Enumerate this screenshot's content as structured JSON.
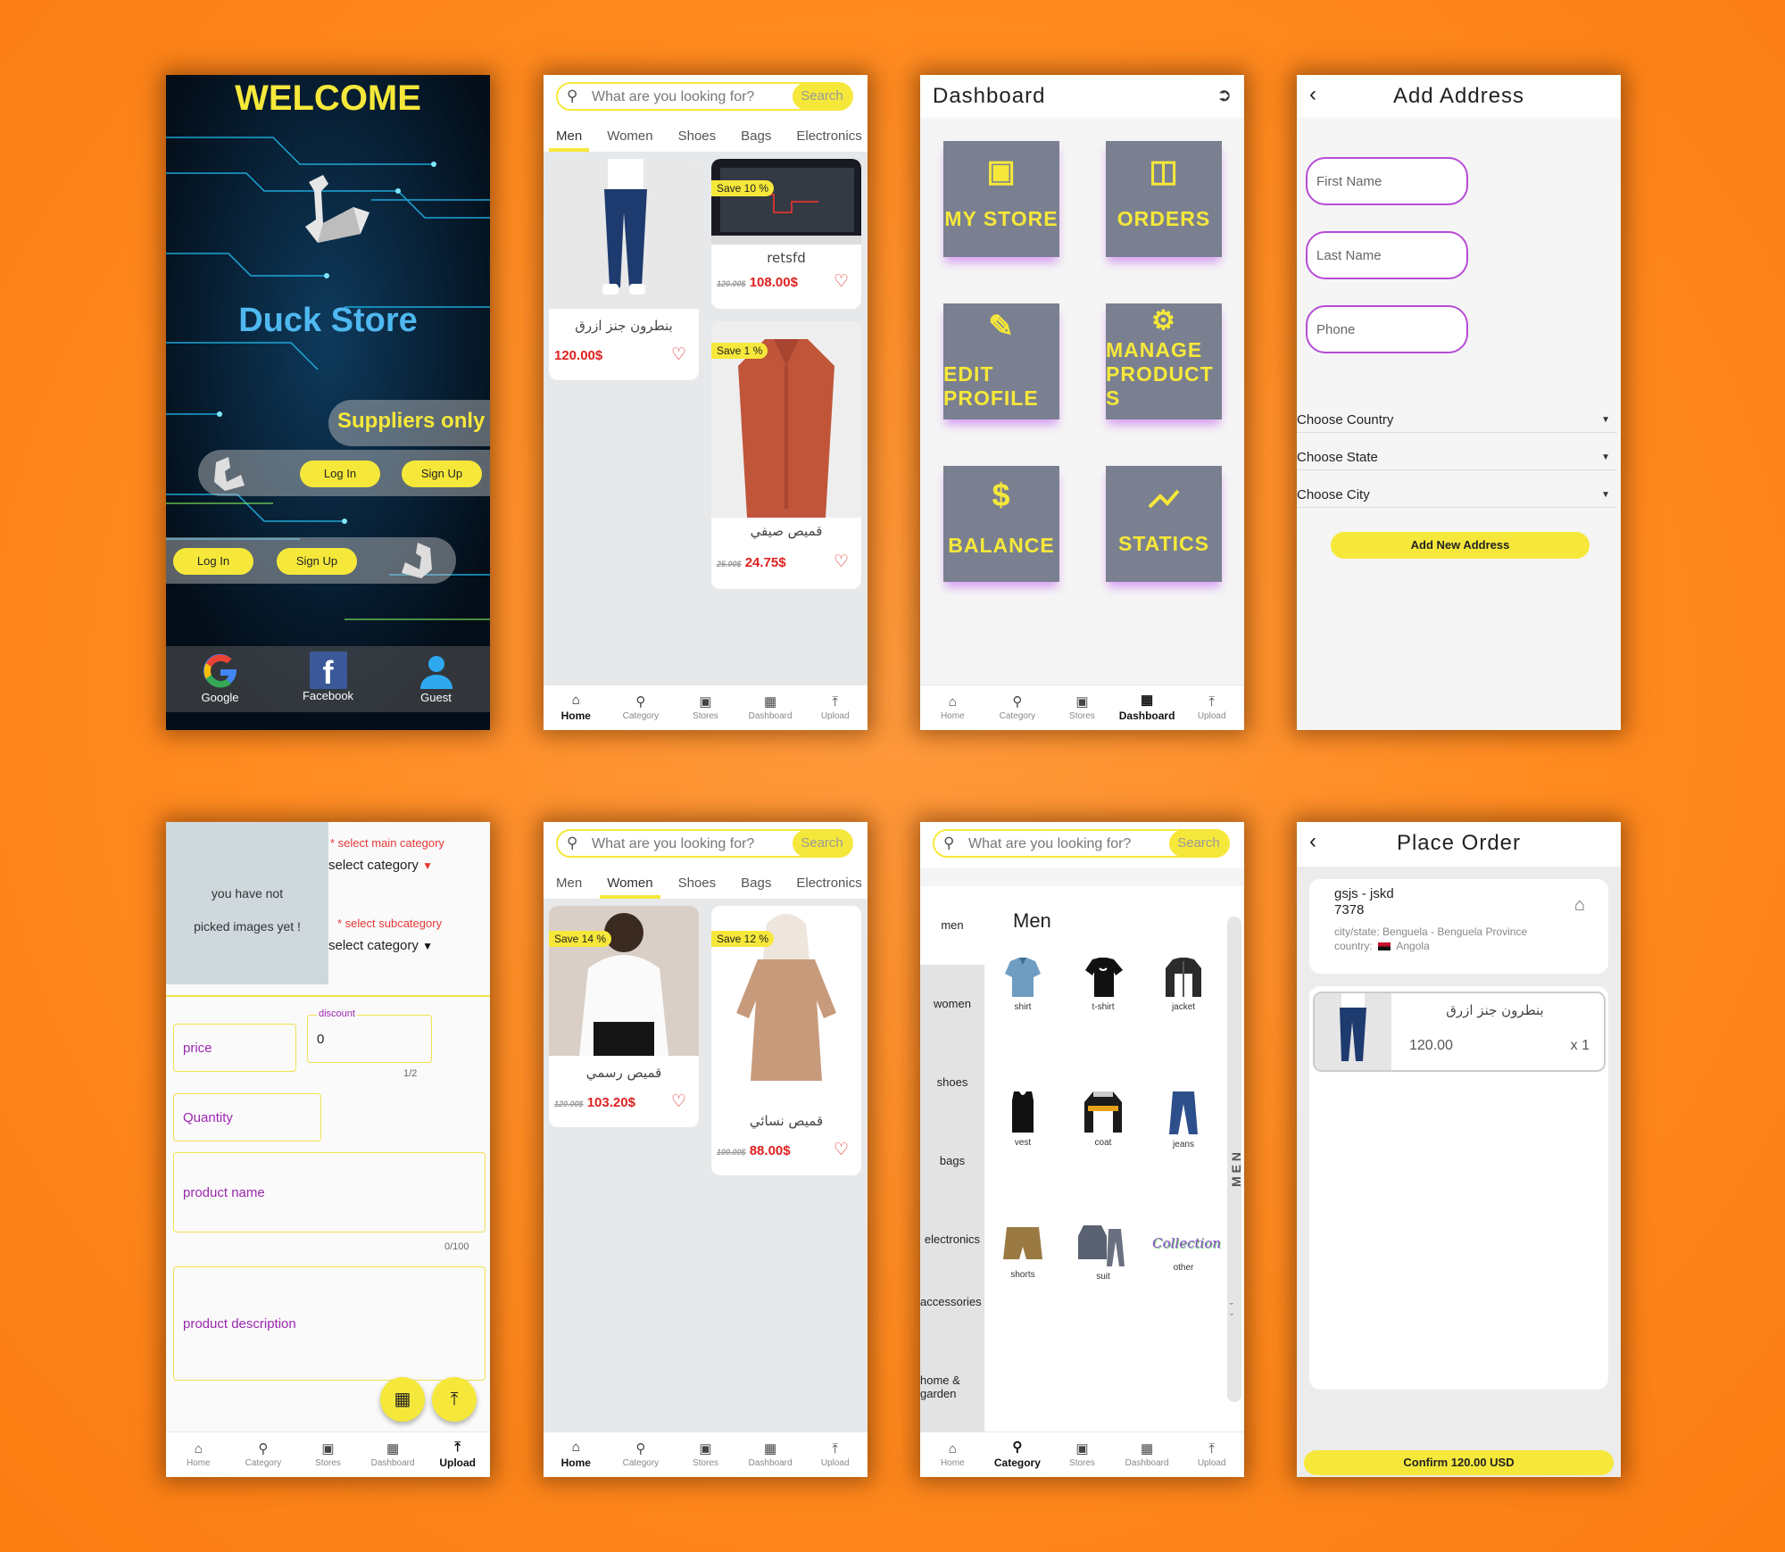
{
  "nav": {
    "home": "Home",
    "category": "Category",
    "stores": "Stores",
    "dashboard": "Dashboard",
    "upload": "Upload"
  },
  "welcome": {
    "title": "WELCOME",
    "store_name": "Duck Store",
    "suppliers_label": "Suppliers only",
    "login": "Log In",
    "signup": "Sign Up",
    "google": "Google",
    "facebook": "Facebook",
    "guest": "Guest"
  },
  "search": {
    "placeholder": "What are you looking for?",
    "button": "Search"
  },
  "tabs": [
    "Men",
    "Women",
    "Shoes",
    "Bags",
    "Electronics"
  ],
  "home_men": {
    "products": [
      {
        "name": "بنطرون جنز ازرق",
        "price": "120.00$"
      },
      {
        "save": "Save 10 %",
        "name": "retsfd",
        "old": "120.00$",
        "price": "108.00$"
      },
      {
        "save": "Save 1 %",
        "name": "قميص صيفي",
        "old": "25.00$",
        "price": "24.75$"
      }
    ]
  },
  "dashboard": {
    "title": "Dashboard",
    "tiles": [
      "MY STORE",
      "ORDERS",
      "EDIT PROFILE",
      "MANAGE PRODUCTS",
      "BALANCE",
      "STATICS"
    ]
  },
  "address": {
    "title": "Add Address",
    "first_name": "First Name",
    "last_name": "Last Name",
    "phone": "Phone",
    "country": "Choose Country",
    "state": "Choose State",
    "city": "Choose City",
    "add_button": "Add New Address"
  },
  "upload": {
    "no_images_line1": "you have not",
    "no_images_line2": "picked images yet !",
    "main_cat_label": "* select main category",
    "main_cat_value": "select category",
    "sub_cat_label": "* select subcategory",
    "sub_cat_value": "select category",
    "price": "price",
    "discount_label": "discount",
    "discount_value": "0",
    "discount_counter": "1/2",
    "quantity": "Quantity",
    "product_name": "product name",
    "name_counter": "0/100",
    "product_description": "product description"
  },
  "home_women": {
    "products": [
      {
        "save": "Save 14 %",
        "name": "قميص رسمي",
        "old": "120.00$",
        "price": "103.20$"
      },
      {
        "save": "Save 12 %",
        "name": "قميص نسائي",
        "old": "100.00$",
        "price": "88.00$"
      }
    ]
  },
  "category": {
    "side": [
      "men",
      "women",
      "shoes",
      "bags",
      "electronics",
      "accessories",
      "home & garden"
    ],
    "heading": "Men",
    "vertical": "M E N",
    "items": [
      "shirt",
      "t-shirt",
      "jacket",
      "vest",
      "coat",
      "jeans",
      "shorts",
      "suit",
      "other"
    ],
    "collection_text": "Collection"
  },
  "order": {
    "title": "Place Order",
    "name": "gsjs - jskd",
    "zip": "7378",
    "city_state": "city/state: Benguela - Benguela Province",
    "country_label": "country:",
    "country": "Angola",
    "product": "بنطرون جنز ازرق",
    "price": "120.00",
    "qty": "x 1",
    "confirm": "Confirm 120.00 USD"
  },
  "colors": {
    "accent_yellow": "#f6e83a",
    "price_red": "#e02020",
    "purple": "#b74bd6",
    "tile_gray": "#7a8090",
    "background_orange": "#ff8a1f"
  }
}
